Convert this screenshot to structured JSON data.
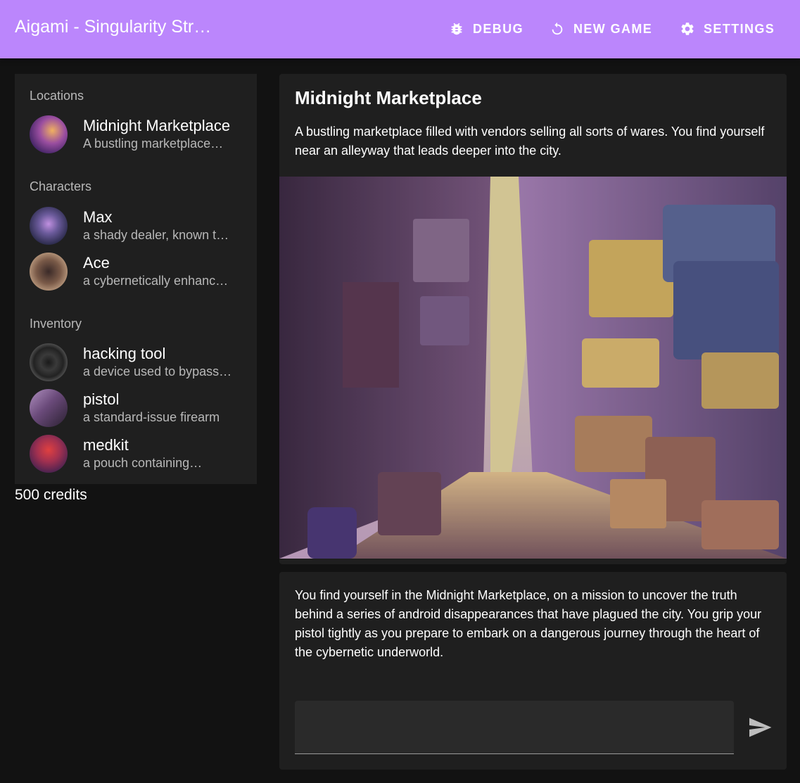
{
  "app": {
    "title": "Aigami - Singularity Str…",
    "nav": {
      "debug": "DEBUG",
      "new_game": "NEW GAME",
      "settings": "SETTINGS"
    }
  },
  "sidebar": {
    "locations_header": "Locations",
    "locations": [
      {
        "title": "Midnight Marketplace",
        "subtitle": "A bustling marketplace…",
        "icon": "market-avatar"
      }
    ],
    "characters_header": "Characters",
    "characters": [
      {
        "title": "Max",
        "subtitle": "a shady dealer, known t…",
        "icon": "max-avatar"
      },
      {
        "title": "Ace",
        "subtitle": "a cybernetically enhanc…",
        "icon": "ace-avatar"
      }
    ],
    "inventory_header": "Inventory",
    "inventory": [
      {
        "title": "hacking tool",
        "subtitle": "a device used to bypass…",
        "icon": "hacking-tool-avatar"
      },
      {
        "title": "pistol",
        "subtitle": "a standard-issue firearm",
        "icon": "pistol-avatar"
      },
      {
        "title": "medkit",
        "subtitle": "a pouch containing…",
        "icon": "medkit-avatar"
      }
    ],
    "credits": "500 credits"
  },
  "location": {
    "title": "Midnight Marketplace",
    "description": "A bustling marketplace filled with vendors selling all sorts of wares. You find yourself near an alleyway that leads deeper into the city."
  },
  "story": {
    "narration": "You find yourself in the Midnight Marketplace, on a mission to uncover the truth behind a series of android disappearances that have plagued the city. You grip your pistol tightly as you prepare to embark on a dangerous journey through the heart of the cybernetic underworld.",
    "input_value": "",
    "input_placeholder": ""
  },
  "colors": {
    "appbar": "#bb86fc",
    "background": "#121212",
    "surface": "#1f1f1f"
  }
}
